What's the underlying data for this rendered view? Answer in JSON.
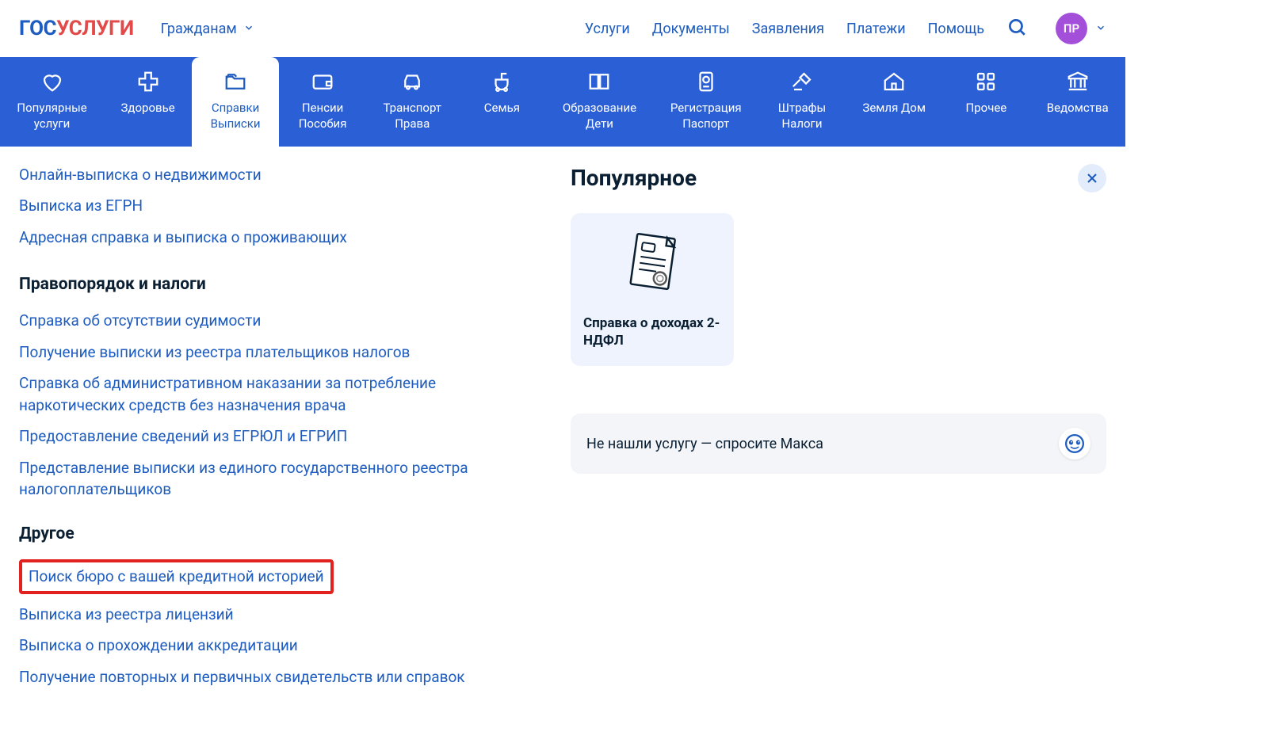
{
  "logo": {
    "gos": "ГОС",
    "uslugi": "УСЛУГИ"
  },
  "audience": "Гражданам",
  "topnav": {
    "services": "Услуги",
    "documents": "Документы",
    "applications": "Заявления",
    "payments": "Платежи",
    "help": "Помощь"
  },
  "avatar": "ПР",
  "categories": [
    {
      "icon": "heart",
      "line1": "Популярные",
      "line2": "услуги",
      "active": false
    },
    {
      "icon": "health",
      "line1": "Здоровье",
      "line2": "",
      "active": false
    },
    {
      "icon": "folder",
      "line1": "Справки",
      "line2": "Выписки",
      "active": true
    },
    {
      "icon": "wallet",
      "line1": "Пенсии",
      "line2": "Пособия",
      "active": false
    },
    {
      "icon": "car",
      "line1": "Транспорт",
      "line2": "Права",
      "active": false
    },
    {
      "icon": "stroller",
      "line1": "Семья",
      "line2": "",
      "active": false
    },
    {
      "icon": "book",
      "line1": "Образование",
      "line2": "Дети",
      "active": false
    },
    {
      "icon": "passport",
      "line1": "Регистрация",
      "line2": "Паспорт",
      "active": false
    },
    {
      "icon": "gavel",
      "line1": "Штрафы",
      "line2": "Налоги",
      "active": false
    },
    {
      "icon": "house",
      "line1": "Земля Дом",
      "line2": "",
      "active": false
    },
    {
      "icon": "grid",
      "line1": "Прочее",
      "line2": "",
      "active": false
    },
    {
      "icon": "agency",
      "line1": "Ведомства",
      "line2": "",
      "active": false
    }
  ],
  "intro_links": [
    "Онлайн-выписка о недвижимости",
    "Выписка из ЕГРН",
    "Адресная справка и выписка о проживающих"
  ],
  "section1": {
    "title": "Правопорядок и налоги",
    "links": [
      "Справка об отсутствии судимости",
      "Получение выписки из реестра плательщиков налогов",
      "Справка об административном наказании за потребление наркотических средств без назначения врача",
      "Предоставление сведений из ЕГРЮЛ и ЕГРИП",
      "Представление выписки из единого государственного реестра налогоплательщиков"
    ]
  },
  "section2": {
    "title": "Другое",
    "links": [
      {
        "text": "Поиск бюро с вашей кредитной историей",
        "highlight": true
      },
      {
        "text": "Выписка из реестра лицензий",
        "highlight": false
      },
      {
        "text": "Выписка о прохождении аккредитации",
        "highlight": false
      },
      {
        "text": "Получение повторных и первичных свидетельств или справок",
        "highlight": false
      }
    ]
  },
  "popular": {
    "title": "Популярное",
    "card": "Справка о доходах 2-НДФЛ"
  },
  "ask": "Не нашли услугу — спросите Макса",
  "colors": {
    "primary_blue": "#2a5fd6",
    "link_blue": "#1e5cbf",
    "highlight_red": "#e2221f",
    "avatar_purple": "#a34fd9"
  }
}
